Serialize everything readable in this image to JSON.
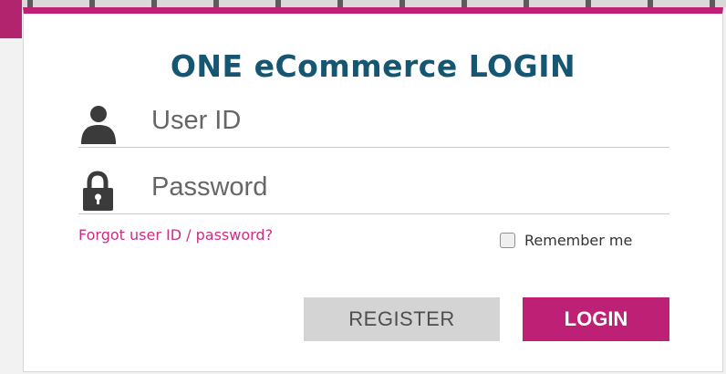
{
  "login": {
    "title": "ONE eCommerce LOGIN",
    "user_id": {
      "value": "",
      "placeholder": "User ID",
      "icon": "user-icon"
    },
    "password": {
      "value": "",
      "placeholder": "Password",
      "icon": "lock-icon"
    },
    "forgot_link": "Forgot user ID / password?",
    "remember_me": {
      "label": "Remember me",
      "checked": false
    },
    "register_label": "REGISTER",
    "login_label": "LOGIN"
  },
  "colors": {
    "accent": "#be2076",
    "title": "#155672",
    "link": "#cc2e86",
    "register_bg": "#d4d4d4"
  }
}
